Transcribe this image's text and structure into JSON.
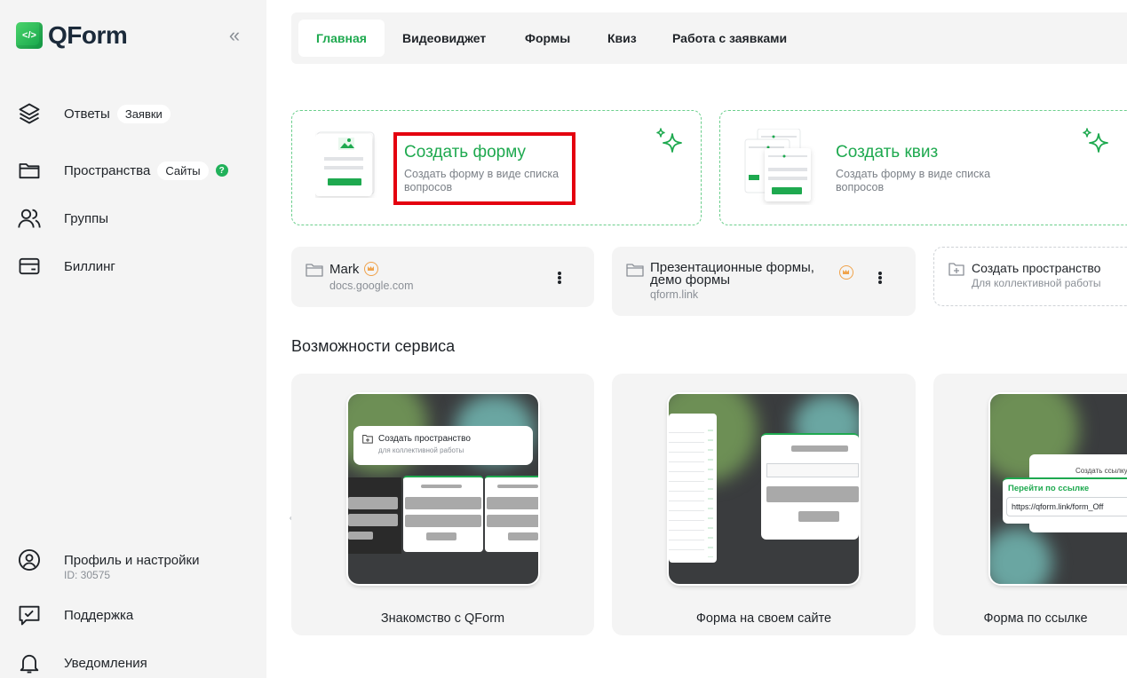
{
  "sidebar": {
    "logo_text": "QForm",
    "logo_mark": "</>",
    "collapse_icon": "«",
    "items": [
      {
        "label": "Ответы",
        "pill": "Заявки"
      },
      {
        "label": "Пространства",
        "pill": "Сайты",
        "badge": "?"
      },
      {
        "label": "Группы"
      },
      {
        "label": "Биллинг"
      }
    ],
    "bottom": [
      {
        "label": "Профиль и настройки",
        "sub": "ID: 30575"
      },
      {
        "label": "Поддержка"
      },
      {
        "label": "Уведомления"
      }
    ]
  },
  "tabs": [
    "Главная",
    "Видеовиджет",
    "Формы",
    "Квиз",
    "Работа с заявками"
  ],
  "active_tab": "Главная",
  "create": [
    {
      "title": "Создать форму",
      "desc_1": "Создать форму в виде списка",
      "desc_2": "вопросов"
    },
    {
      "title": "Создать квиз",
      "desc_1": "Создать форму в виде списка",
      "desc_2": "вопросов"
    }
  ],
  "spaces": [
    {
      "name": "Mark",
      "url": "docs.google.com"
    },
    {
      "name_1": "Презентационные формы,",
      "name_2": "демо формы",
      "url": "qform.link"
    }
  ],
  "new_space": {
    "title": "Создать пространство",
    "desc": "Для коллективной работы"
  },
  "features_title": "Возможности сервиса",
  "features": [
    {
      "label": "Знакомство с QForm",
      "overlay_title": "Создать пространство",
      "overlay_desc": "для коллективной работы"
    },
    {
      "label": "Форма на своем сайте"
    },
    {
      "label": "Форма по ссылке",
      "overlay_title": "Перейти по ссылке",
      "overlay_url": "https://qform.link/form_Off",
      "overlay_header": "Создать ссылку"
    }
  ],
  "colors": {
    "accent": "#1ea94f",
    "highlight": "#e4000f",
    "sidebar_bg": "#f4f4f4"
  }
}
